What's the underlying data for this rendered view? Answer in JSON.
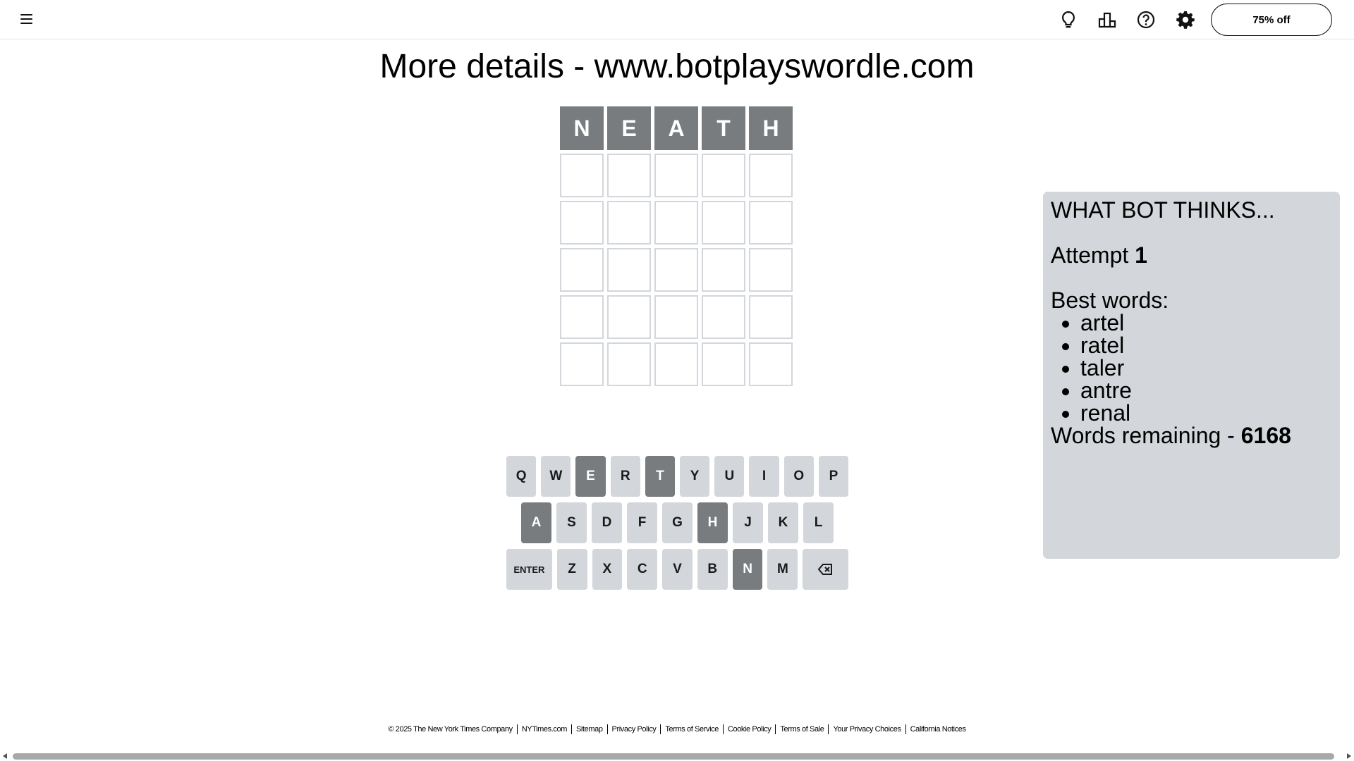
{
  "header": {
    "menu_icon": "hamburger-icon",
    "icons": [
      "lightbulb-icon",
      "stats-bar-chart-icon",
      "help-question-icon",
      "settings-gear-icon"
    ],
    "offer_label": "75% off"
  },
  "page_title": "More details - www.botplayswordle.com",
  "board": {
    "rows": [
      [
        "N",
        "E",
        "A",
        "T",
        "H"
      ],
      [
        "",
        "",
        "",
        "",
        ""
      ],
      [
        "",
        "",
        "",
        "",
        ""
      ],
      [
        "",
        "",
        "",
        "",
        ""
      ],
      [
        "",
        "",
        "",
        "",
        ""
      ],
      [
        "",
        "",
        "",
        "",
        ""
      ]
    ],
    "row_states": [
      "absent",
      "empty",
      "empty",
      "empty",
      "empty",
      "empty"
    ]
  },
  "keyboard": {
    "rows": [
      [
        "Q",
        "W",
        "E",
        "R",
        "T",
        "Y",
        "U",
        "I",
        "O",
        "P"
      ],
      [
        "A",
        "S",
        "D",
        "F",
        "G",
        "H",
        "J",
        "K",
        "L"
      ],
      [
        "ENTER",
        "Z",
        "X",
        "C",
        "V",
        "B",
        "N",
        "M",
        "backspace-icon"
      ]
    ],
    "absent_keys": [
      "E",
      "T",
      "A",
      "H",
      "N"
    ]
  },
  "bot_panel": {
    "title": "WHAT BOT THINKS...",
    "attempt_label": "Attempt",
    "attempt_number": "1",
    "best_words_label": "Best words:",
    "best_words": [
      "artel",
      "ratel",
      "taler",
      "antre",
      "renal"
    ],
    "remaining_label": "Words remaining -",
    "remaining_count": "6168"
  },
  "footer": {
    "links": [
      "© 2025 The New York Times Company",
      "NYTimes.com",
      "Sitemap",
      "Privacy Policy",
      "Terms of Service",
      "Cookie Policy",
      "Terms of Sale",
      "Your Privacy Choices",
      "California Notices"
    ]
  },
  "colors": {
    "absent": "#787c7e",
    "key_default": "#d3d6da",
    "tile_border": "#d3d6da",
    "panel_bg": "#d3d6da"
  }
}
